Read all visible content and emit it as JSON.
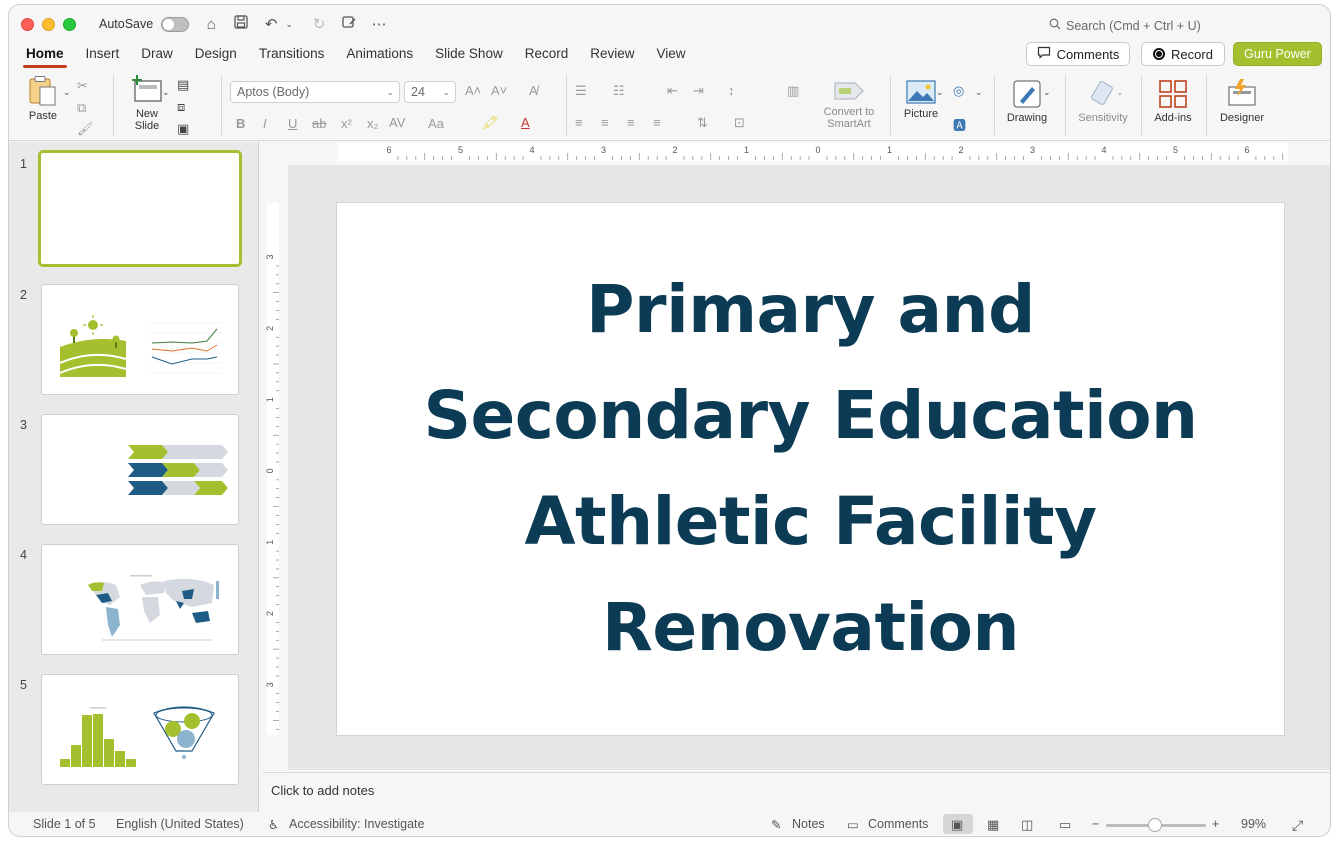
{
  "titlebar": {
    "autosave_label": "AutoSave",
    "search_placeholder": "Search (Cmd + Ctrl + U)"
  },
  "tabs": [
    "Home",
    "Insert",
    "Draw",
    "Design",
    "Transitions",
    "Animations",
    "Slide Show",
    "Record",
    "Review",
    "View"
  ],
  "active_tab": "Home",
  "header_buttons": {
    "comments": "Comments",
    "record": "Record",
    "guru": "Guru Power"
  },
  "ribbon": {
    "paste": "Paste",
    "new_slide_1": "New",
    "new_slide_2": "Slide",
    "font_name": "Aptos (Body)",
    "font_size": "24",
    "convert_1": "Convert to",
    "convert_2": "SmartArt",
    "picture": "Picture",
    "drawing": "Drawing",
    "sensitivity": "Sensitivity",
    "addins": "Add-ins",
    "designer": "Designer"
  },
  "colors": {
    "accent_green": "#a5c02e",
    "title_navy": "#0b3b55",
    "tab_underline": "#c43e1c",
    "chart_blue": "#1f5c85",
    "chart_gray": "#d4d9df"
  },
  "slides": [
    {
      "number": "1"
    },
    {
      "number": "2"
    },
    {
      "number": "3"
    },
    {
      "number": "4"
    },
    {
      "number": "5"
    }
  ],
  "main_slide": {
    "title_lines": [
      "Primary and",
      "Secondary Education",
      "Athletic Facility",
      "Renovation"
    ]
  },
  "rulers": {
    "horizontal": [
      "6",
      "5",
      "4",
      "3",
      "2",
      "1",
      "0",
      "1",
      "2",
      "3",
      "4",
      "5",
      "6"
    ],
    "vertical": [
      "3",
      "2",
      "1",
      "0",
      "1",
      "2",
      "3"
    ]
  },
  "notes_placeholder": "Click to add notes",
  "status": {
    "slide_info": "Slide 1 of 5",
    "language": "English (United States)",
    "accessibility": "Accessibility: Investigate",
    "notes": "Notes",
    "comments": "Comments",
    "zoom": "99%"
  }
}
